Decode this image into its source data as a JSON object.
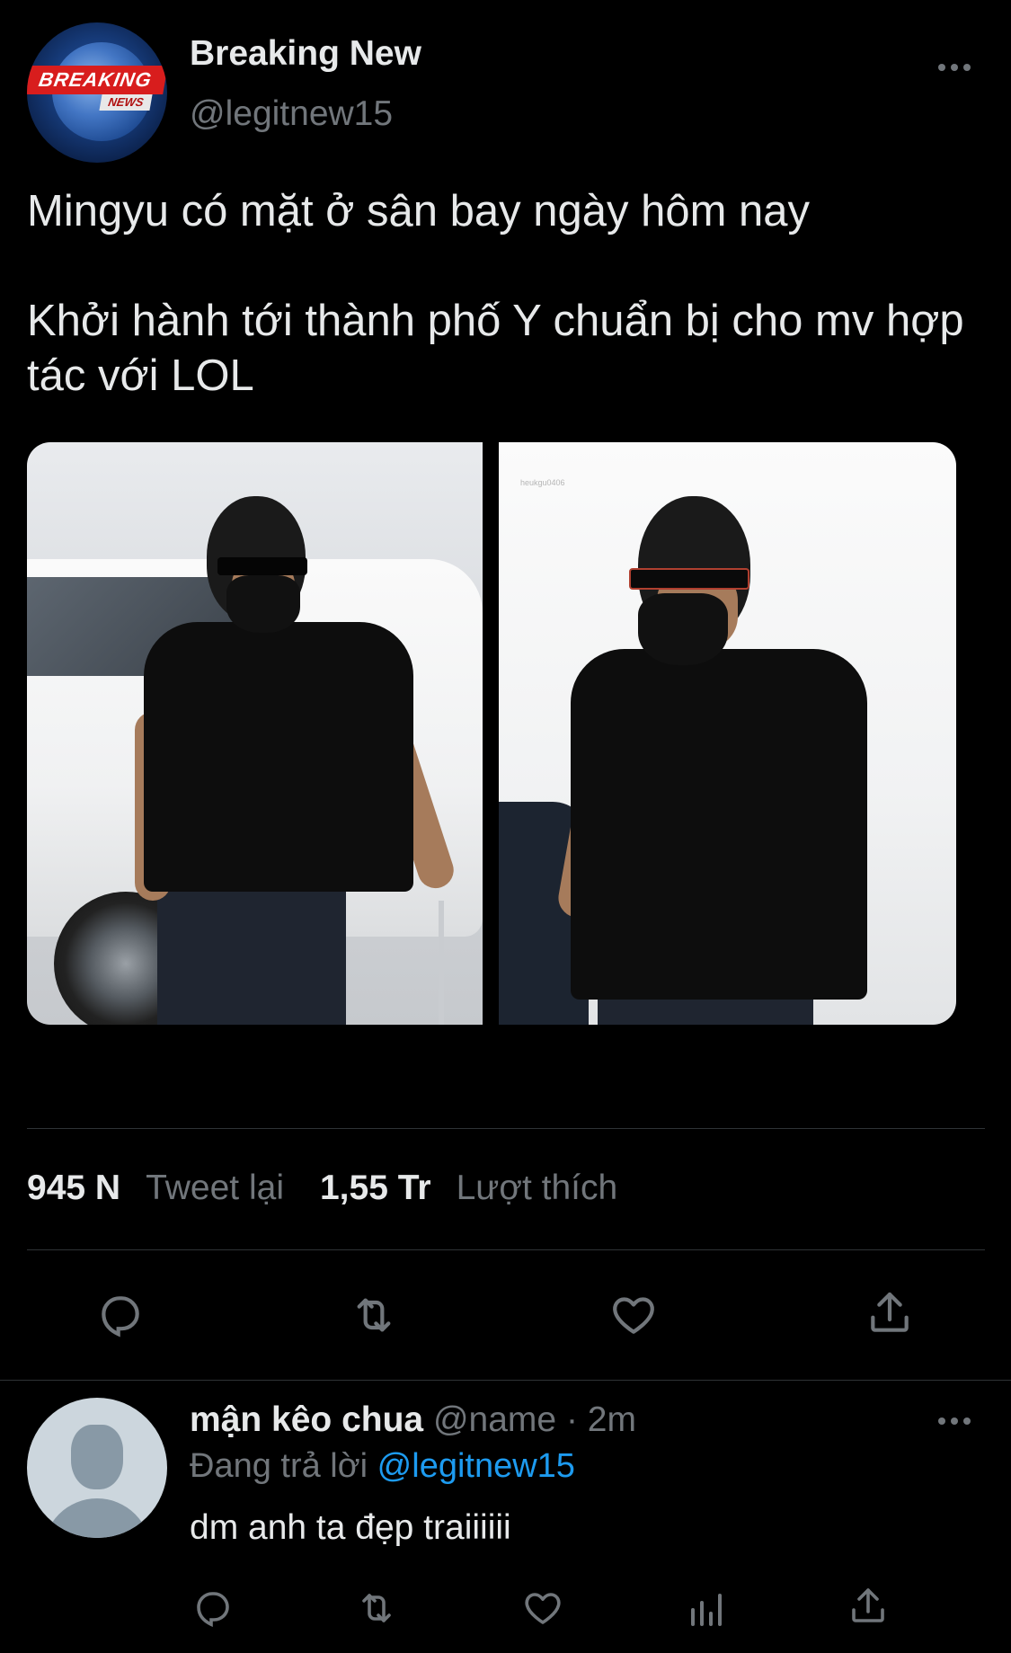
{
  "tweet": {
    "author": {
      "name": "Breaking New",
      "handle": "@legitnew15",
      "avatar_text_top": "BREAKING",
      "avatar_text_bottom": "NEWS"
    },
    "text": "Mingyu có mặt ở sân bay ngày hôm nay\n\nKhởi hành tới thành phố Y chuẩn bị cho mv hợp tác với LOL",
    "media": {
      "photo_2_watermark": "heukgu0406"
    },
    "stats": {
      "retweets_count": "945 N",
      "retweets_label": "Tweet lại",
      "likes_count": "1,55 Tr",
      "likes_label": "Lượt thích"
    },
    "actions": [
      "reply-icon",
      "retweet-icon",
      "like-icon",
      "share-icon"
    ]
  },
  "reply": {
    "name": "mận kêo chua",
    "handle": "@name",
    "separator": "·",
    "time": "2m",
    "replying_prefix": "Đang trả lời",
    "replying_to": "@legitnew15",
    "text": "dm anh ta đẹp traiiiiii",
    "actions": [
      "reply-icon",
      "retweet-icon",
      "like-icon",
      "analytics-icon",
      "share-icon"
    ]
  },
  "colors": {
    "background": "#000000",
    "text": "#e7e9ea",
    "muted": "#71767b",
    "link": "#1d9bf0",
    "divider": "#2f3336"
  }
}
